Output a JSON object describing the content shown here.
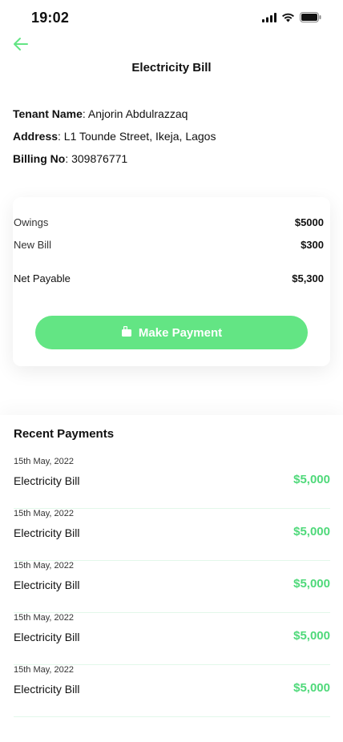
{
  "status_bar": {
    "time": "19:02"
  },
  "header": {
    "title": "Electricity Bill"
  },
  "tenant": {
    "name_label": "Tenant Name",
    "name_value": ": Anjorin Abdulrazzaq",
    "address_label": "Address",
    "address_value": ": L1 Tounde Street, Ikeja, Lagos",
    "billing_label": "Billing No",
    "billing_value": ": 309876771"
  },
  "bill": {
    "owings_label": "Owings",
    "owings_value": "$5000",
    "new_bill_label": "New Bill",
    "new_bill_value": "$300",
    "net_label": "Net Payable",
    "net_value": "$5,300",
    "pay_button": "Make Payment"
  },
  "recent": {
    "title": "Recent Payments",
    "items": [
      {
        "date": "15th May, 2022",
        "name": "Electricity Bill",
        "amount": "$5,000"
      },
      {
        "date": "15th May, 2022",
        "name": "Electricity Bill",
        "amount": "$5,000"
      },
      {
        "date": "15th May, 2022",
        "name": "Electricity Bill",
        "amount": "$5,000"
      },
      {
        "date": "15th May, 2022",
        "name": "Electricity Bill",
        "amount": "$5,000"
      },
      {
        "date": "15th May, 2022",
        "name": "Electricity Bill",
        "amount": "$5,000"
      }
    ]
  },
  "colors": {
    "accent": "#63e584",
    "amount_green": "#4fd97a",
    "divider": "#e2f8ea"
  },
  "icons": {
    "back": "arrow-left-icon",
    "pay": "wallet-icon",
    "signal": "signal-icon",
    "wifi": "wifi-icon",
    "battery": "battery-icon"
  }
}
